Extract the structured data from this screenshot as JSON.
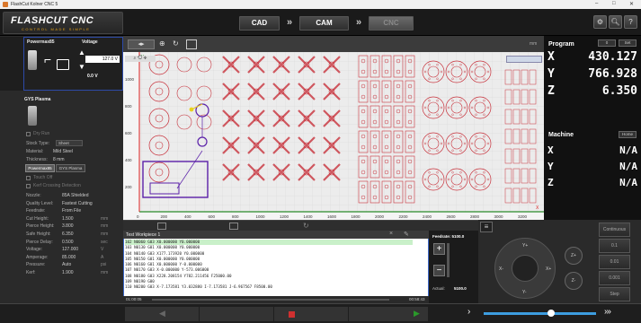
{
  "window": {
    "title": "FlashCut Kolner CNC 5",
    "minimize": "–",
    "maximize": "□",
    "close": "✕"
  },
  "logo": {
    "line1": "FLASHCUT CNC",
    "line2": "CONTROL MADE SIMPLE"
  },
  "tabs": {
    "cad": "CAD",
    "cam": "CAM",
    "cnc": "CNC"
  },
  "toolbar_icons": [
    "gears-icon",
    "search-icon",
    "help-icon"
  ],
  "help_glyph": "?",
  "plasma": {
    "powermax_title": "Powermax85",
    "voltage_title": "Voltage",
    "voltage_set": "127.0 V",
    "voltage_actual": "0.0 V",
    "gys_title": "GYS Plasma"
  },
  "settings": {
    "dry_run": "Dry Run",
    "rows": [
      {
        "label": "Stock Type:",
        "value": "Sheet",
        "unit": ""
      },
      {
        "label": "Material:",
        "value": "Mild Steel",
        "unit": ""
      },
      {
        "label": "Thickness:",
        "value": "8 mm",
        "unit": ""
      }
    ],
    "btn_powermax": "Powermax85",
    "btn_gys": "GYS Plasma",
    "touch_off": "Touch Off",
    "kerf": "Kerf Crossing Detection",
    "params": [
      {
        "label": "Nozzle:",
        "value": "85A Shielded",
        "unit": ""
      },
      {
        "label": "Quality Level:",
        "value": "Fastest Cutting",
        "unit": ""
      },
      {
        "label": "Feedrate:",
        "value": "From File",
        "unit": ""
      },
      {
        "label": "Cut Height:",
        "value": "1.500",
        "unit": "mm"
      },
      {
        "label": "Pierce Height:",
        "value": "3.800",
        "unit": "mm"
      },
      {
        "label": "Safe Height:",
        "value": "6.350",
        "unit": "mm"
      },
      {
        "label": "Pierce Delay:",
        "value": "0.500",
        "unit": "sec"
      },
      {
        "label": "Voltage:",
        "value": "127.000",
        "unit": "V"
      },
      {
        "label": "Amperage:",
        "value": "85.000",
        "unit": "A"
      },
      {
        "label": "Pressure:",
        "value": "Auto",
        "unit": "psi"
      },
      {
        "label": "Kerf:",
        "value": "1.900",
        "unit": "mm"
      }
    ]
  },
  "canvas": {
    "y_ticks": [
      "1000",
      "800",
      "600",
      "400",
      "200"
    ],
    "x_ticks": [
      "0",
      "200",
      "400",
      "600",
      "800",
      "1000",
      "1200",
      "1400",
      "1600",
      "1800",
      "2000",
      "2200",
      "2400",
      "2600",
      "2800",
      "3000",
      "3200"
    ],
    "mm_label": "mm",
    "axis_x": "X",
    "axis_y": "Y"
  },
  "dro": {
    "program_title": "Program",
    "btn_zero": "0",
    "btn_set": "Set",
    "prog_x": "430.127",
    "prog_y": "766.928",
    "prog_z": "6.350",
    "machine_title": "Machine",
    "btn_home": "Home",
    "mach_x": "N/A",
    "mach_y": "N/A",
    "mach_z": "N/A",
    "axis_x": "X",
    "axis_y": "Y",
    "axis_z": "Z"
  },
  "gcode": {
    "title": "Test Workpiece 1",
    "lines": [
      "102  N0060 G03 X0.000000 Y0.000000",
      "103  N0130 G01 X0.000000 Y0.000000",
      "104  N0140 G03 X177.173920 Y0.000000",
      "105  N0150 G01 X0.000000 Y0.000000",
      "106  N0160 G01 X0.000000 Y-0.000000",
      "107  N0170 G03 X-0.000000 Y-573.006000",
      "108  N0180 G03 X228.208154 Y782.211456 F25000.00",
      "109  N0190 G00",
      "110  N0200 G03 X-7.173581 Y3.032880 I-7.173581 J-6.967567 F8500.00"
    ],
    "time_start": "01:00:05",
    "time_end": "00:58:43"
  },
  "feed": {
    "title": "Feedrate: 5100.0",
    "actual_label": "Actual:",
    "actual_value": "5100.0",
    "plus": "+",
    "minus": "−"
  },
  "jog": {
    "y_plus": "Y+",
    "y_minus": "Y-",
    "x_plus": "X+",
    "x_minus": "X-",
    "z_plus": "Z+",
    "z_minus": "Z-",
    "modes": [
      "Continuous",
      "0.1",
      "0.01",
      "0.001",
      "Step"
    ],
    "speed_arrows": "›››",
    "speed_level": 0.6
  }
}
